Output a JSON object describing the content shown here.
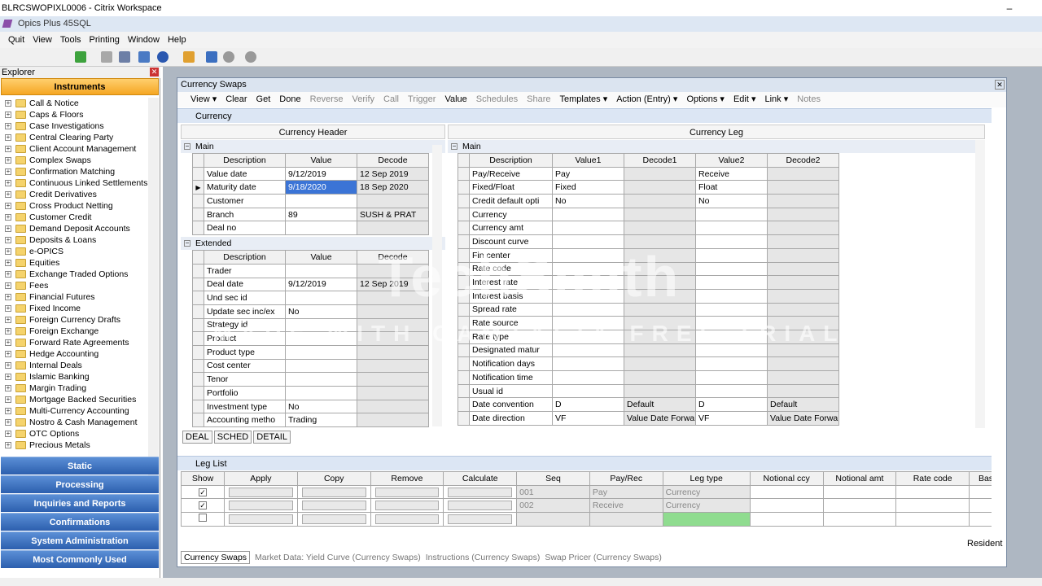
{
  "window": {
    "title": "BLRCSWOPIXL0006 - Citrix Workspace",
    "app_title": "Opics Plus 45SQL"
  },
  "menu": [
    "Quit",
    "View",
    "Tools",
    "Printing",
    "Window",
    "Help"
  ],
  "explorer": {
    "title": "Explorer",
    "section": "Instruments",
    "items": [
      "Call & Notice",
      "Caps & Floors",
      "Case Investigations",
      "Central Clearing Party",
      "Client Account Management",
      "Complex Swaps",
      "Confirmation Matching",
      "Continuous Linked Settlements",
      "Credit Derivatives",
      "Cross Product Netting",
      "Customer Credit",
      "Demand Deposit Accounts",
      "Deposits & Loans",
      "e-OPICS",
      "Equities",
      "Exchange Traded Options",
      "Fees",
      "Financial Futures",
      "Fixed Income",
      "Foreign Currency Drafts",
      "Foreign Exchange",
      "Forward Rate Agreements",
      "Hedge Accounting",
      "Internal Deals",
      "Islamic Banking",
      "Margin Trading",
      "Mortgage Backed Securities",
      "Multi-Currency Accounting",
      "Nostro & Cash Management",
      "OTC Options",
      "Precious Metals"
    ],
    "nav": [
      "Static",
      "Processing",
      "Inquiries and Reports",
      "Confirmations",
      "System Administration",
      "Most Commonly Used"
    ]
  },
  "cs": {
    "title": "Currency Swaps",
    "toolbar": [
      {
        "l": "View ▾",
        "d": false
      },
      {
        "l": "Clear",
        "d": false
      },
      {
        "l": "Get",
        "d": false
      },
      {
        "l": "Done",
        "d": false
      },
      {
        "l": "Reverse",
        "d": true
      },
      {
        "l": "Verify",
        "d": true
      },
      {
        "l": "Call",
        "d": true
      },
      {
        "l": "Trigger",
        "d": true
      },
      {
        "l": "Value",
        "d": false
      },
      {
        "l": "Schedules",
        "d": true
      },
      {
        "l": "Share",
        "d": true
      },
      {
        "l": "Templates ▾",
        "d": false
      },
      {
        "l": "Action (Entry) ▾",
        "d": false
      },
      {
        "l": "Options ▾",
        "d": false
      },
      {
        "l": "Edit ▾",
        "d": false
      },
      {
        "l": "Link ▾",
        "d": false
      },
      {
        "l": "Notes",
        "d": true
      }
    ],
    "section": "Currency",
    "header_title": "Currency Header",
    "leg_title": "Currency Leg",
    "main_label": "Main",
    "extended_label": "Extended",
    "hdr_cols": [
      "Description",
      "Value",
      "Decode"
    ],
    "main_rows": [
      [
        "Value date",
        "9/12/2019",
        "12 Sep 2019"
      ],
      [
        "Maturity date",
        "9/18/2020",
        "18 Sep 2020"
      ],
      [
        "Customer",
        "",
        ""
      ],
      [
        "Branch",
        "89",
        "SUSH & PRAT"
      ],
      [
        "Deal no",
        "",
        ""
      ]
    ],
    "ext_rows": [
      [
        "Trader",
        "",
        ""
      ],
      [
        "Deal date",
        "9/12/2019",
        "12 Sep 2019"
      ],
      [
        "Und sec id",
        "",
        ""
      ],
      [
        "Update sec inc/ex",
        "No",
        ""
      ],
      [
        "Strategy id",
        "",
        ""
      ],
      [
        "Product",
        "",
        ""
      ],
      [
        "Product type",
        "",
        ""
      ],
      [
        "Cost center",
        "",
        ""
      ],
      [
        "Tenor",
        "",
        ""
      ],
      [
        "Portfolio",
        "",
        ""
      ],
      [
        "Investment type",
        "No",
        ""
      ],
      [
        "Accounting metho",
        "Trading",
        ""
      ]
    ],
    "leg_cols": [
      "Description",
      "Value1",
      "Decode1",
      "Value2",
      "Decode2"
    ],
    "leg_rows": [
      [
        "Pay/Receive",
        "Pay",
        "",
        "Receive",
        ""
      ],
      [
        "Fixed/Float",
        "Fixed",
        "",
        "Float",
        ""
      ],
      [
        "Credit default opti",
        "No",
        "",
        "No",
        ""
      ],
      [
        "Currency",
        "",
        "",
        "",
        ""
      ],
      [
        "Currency amt",
        "",
        "",
        "",
        ""
      ],
      [
        "Discount curve",
        "",
        "",
        "",
        ""
      ],
      [
        "Fin center",
        "",
        "",
        "",
        ""
      ],
      [
        "Rate code",
        "",
        "",
        "",
        ""
      ],
      [
        "Interest rate",
        "",
        "",
        "",
        ""
      ],
      [
        "Interest basis",
        "",
        "",
        "",
        ""
      ],
      [
        "Spread rate",
        "",
        "",
        "",
        ""
      ],
      [
        "Rate source",
        "",
        "",
        "",
        ""
      ],
      [
        "Rate type",
        "",
        "",
        "",
        ""
      ],
      [
        "Designated matur",
        "",
        "",
        "",
        ""
      ],
      [
        "Notification days",
        "",
        "",
        "",
        ""
      ],
      [
        "Notification time",
        "",
        "",
        "",
        ""
      ],
      [
        "Usual id",
        "",
        "",
        "",
        ""
      ],
      [
        "Date convention",
        "D",
        "Default",
        "D",
        "Default"
      ],
      [
        "Date direction",
        "VF",
        "Value Date Forwa",
        "VF",
        "Value Date Forwa"
      ]
    ],
    "tabs": [
      "DEAL",
      "SCHED",
      "DETAIL"
    ],
    "leglist_label": "Leg List",
    "ll_cols": [
      "Show",
      "Apply",
      "Copy",
      "Remove",
      "Calculate",
      "Seq",
      "Pay/Rec",
      "Leg type",
      "Notional ccy",
      "Notional amt",
      "Rate code",
      "Bas"
    ],
    "ll_rows": [
      [
        "001",
        "Pay",
        "Currency"
      ],
      [
        "002",
        "Receive",
        "Currency"
      ],
      [
        "",
        "",
        ""
      ]
    ],
    "status": "Resident",
    "bottom_tabs": [
      "Currency Swaps",
      "Market Data: Yield Curve (Currency Swaps)",
      "Instructions (Currency Swaps)",
      "Swap Pricer (Currency Swaps)"
    ]
  },
  "watermark": {
    "line1": "TechSmith",
    "line2": "MADE WITH CAMTASIA FREE TRIAL"
  }
}
